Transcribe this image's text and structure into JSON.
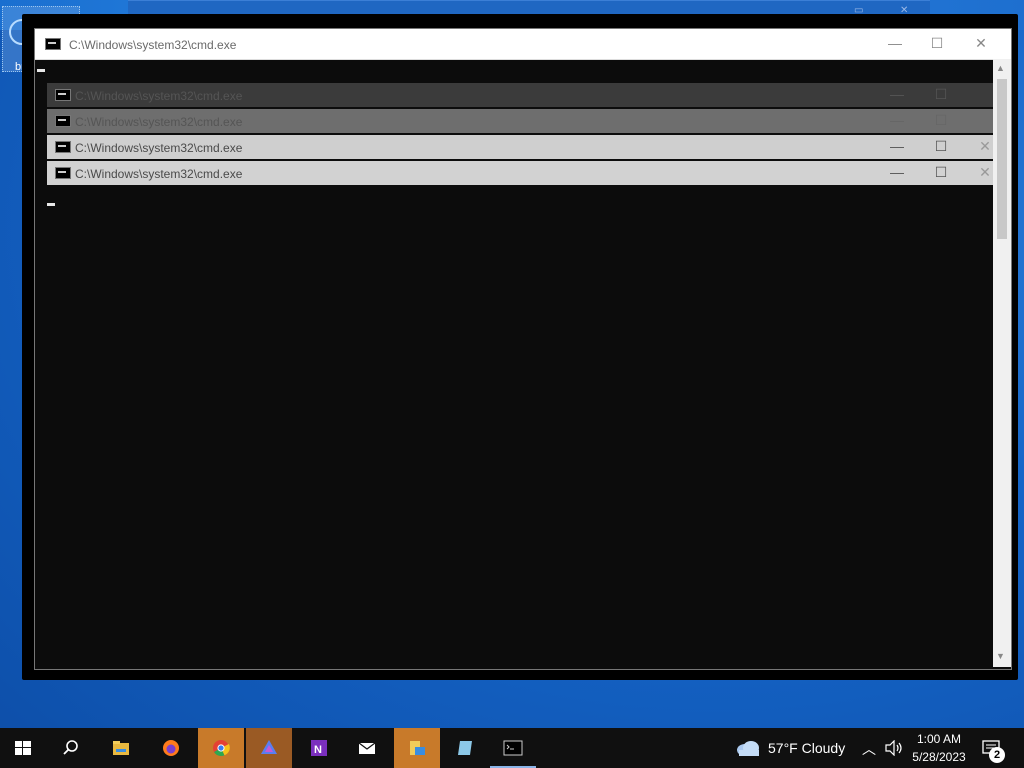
{
  "desktop": {
    "icon_label": "br"
  },
  "window": {
    "title": "C:\\Windows\\system32\\cmd.exe",
    "minimize": "—",
    "maximize": "☐",
    "close": "✕"
  },
  "stacked_windows": [
    {
      "title": "C:\\Windows\\system32\\cmd.exe"
    },
    {
      "title": "C:\\Windows\\system32\\cmd.exe"
    },
    {
      "title": "C:\\Windows\\system32\\cmd.exe"
    },
    {
      "title": "C:\\Windows\\system32\\cmd.exe"
    }
  ],
  "taskbar": {
    "apps": [
      "start-icon",
      "search-icon",
      "file-explorer-icon",
      "firefox-icon",
      "chrome-icon",
      "app-icon",
      "onenote-icon",
      "mail-icon",
      "files-icon",
      "app-icon",
      "terminal-icon"
    ],
    "weather": "57°F  Cloudy",
    "time": "1:00 AM",
    "date": "5/28/2023",
    "notification_count": "2"
  },
  "colors": {
    "accent": "#c87a2a",
    "desktop": "#1565c8",
    "console": "#0c0c0c"
  }
}
